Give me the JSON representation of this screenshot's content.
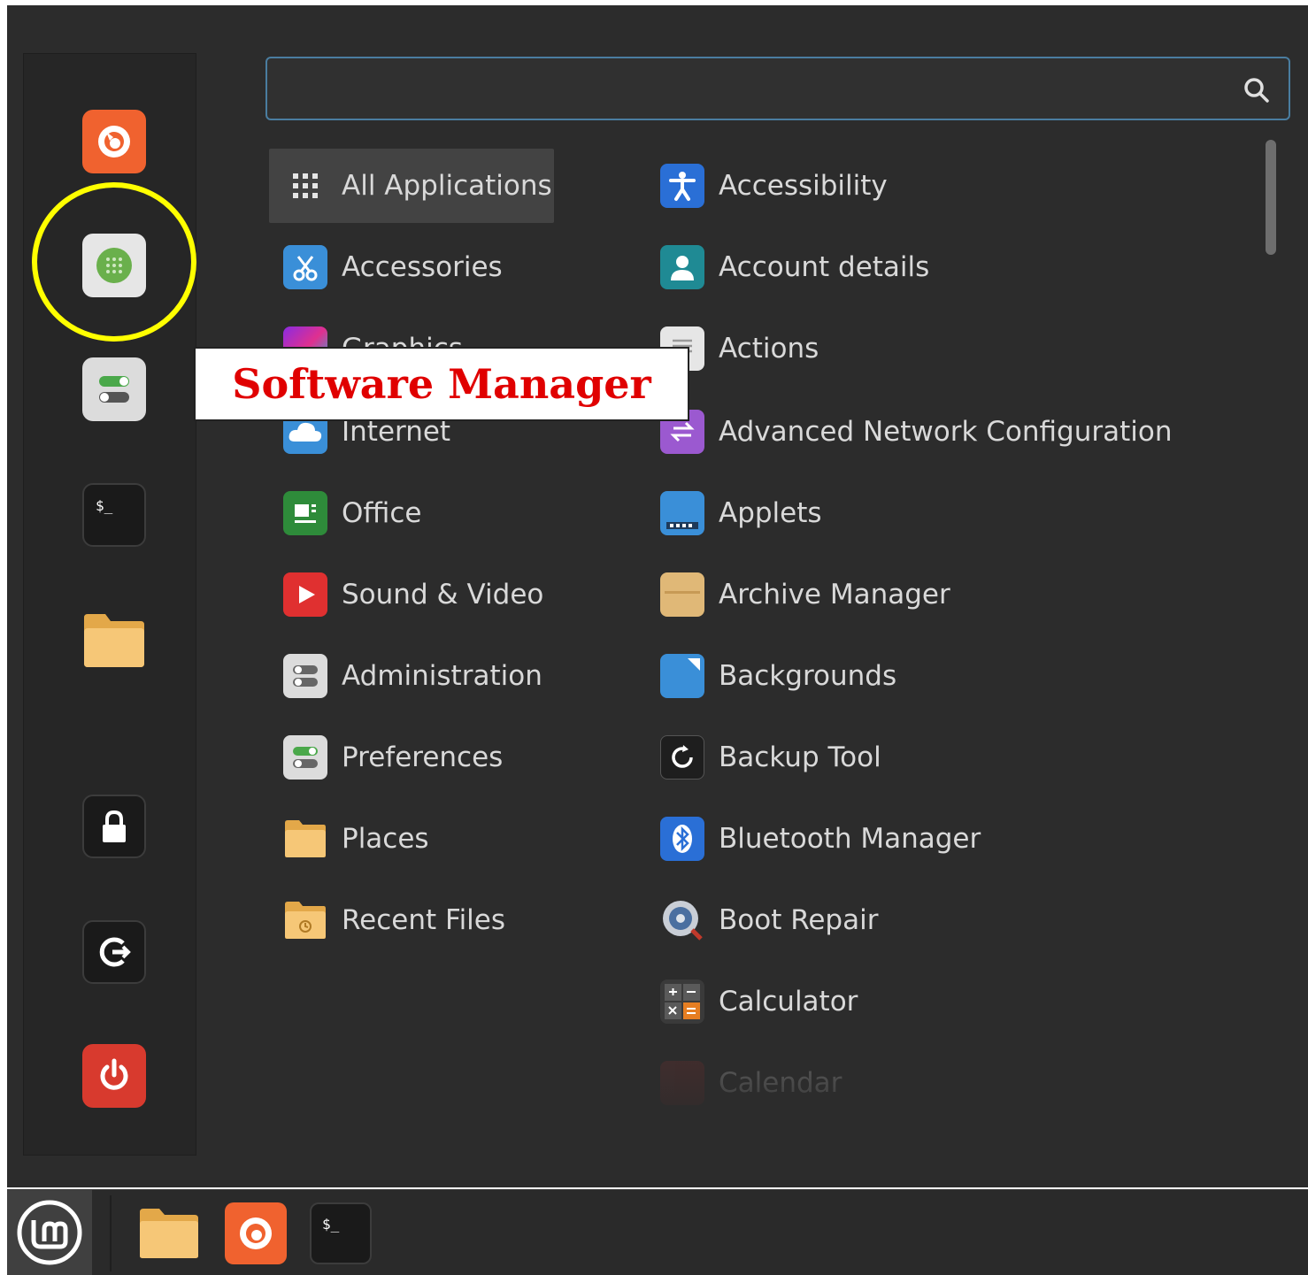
{
  "search": {
    "value": "",
    "placeholder": ""
  },
  "favorites": [
    {
      "name": "Firefox",
      "icon": "firefox-icon"
    },
    {
      "name": "Software Manager",
      "icon": "software-manager-icon"
    },
    {
      "name": "System Settings",
      "icon": "settings-toggle-icon"
    },
    {
      "name": "Terminal",
      "icon": "terminal-icon"
    },
    {
      "name": "Files",
      "icon": "folder-icon"
    },
    {
      "name": "Lock Screen",
      "icon": "lock-icon"
    },
    {
      "name": "Log Out",
      "icon": "logout-icon"
    },
    {
      "name": "Quit",
      "icon": "power-icon"
    }
  ],
  "categories": [
    {
      "label": "All Applications",
      "icon": "grid-dots-icon",
      "active": true
    },
    {
      "label": "Accessories",
      "icon": "scissors-icon"
    },
    {
      "label": "Graphics",
      "icon": "graphics-icon"
    },
    {
      "label": "Internet",
      "icon": "cloud-icon"
    },
    {
      "label": "Office",
      "icon": "office-icon"
    },
    {
      "label": "Sound & Video",
      "icon": "play-icon"
    },
    {
      "label": "Administration",
      "icon": "admin-toggle-icon"
    },
    {
      "label": "Preferences",
      "icon": "preferences-toggle-icon"
    },
    {
      "label": "Places",
      "icon": "folder-icon"
    },
    {
      "label": "Recent Files",
      "icon": "recent-folder-icon"
    }
  ],
  "apps": [
    {
      "label": "Accessibility",
      "icon": "accessibility-icon"
    },
    {
      "label": "Account details",
      "icon": "account-icon"
    },
    {
      "label": "Actions",
      "icon": "actions-icon"
    },
    {
      "label": "Advanced Network Configuration",
      "icon": "network-config-icon"
    },
    {
      "label": "Applets",
      "icon": "applets-icon"
    },
    {
      "label": "Archive Manager",
      "icon": "archive-icon"
    },
    {
      "label": "Backgrounds",
      "icon": "backgrounds-icon"
    },
    {
      "label": "Backup Tool",
      "icon": "backup-icon"
    },
    {
      "label": "Bluetooth Manager",
      "icon": "bluetooth-icon"
    },
    {
      "label": "Boot Repair",
      "icon": "boot-repair-icon"
    },
    {
      "label": "Calculator",
      "icon": "calculator-icon"
    },
    {
      "label": "Calendar",
      "icon": "calendar-icon"
    }
  ],
  "annotation": {
    "label": "Software Manager",
    "ring_color": "#ffff00",
    "text_color": "#e00000"
  },
  "taskbar": [
    {
      "name": "Menu",
      "icon": "linux-mint-logo-icon"
    },
    {
      "name": "Files",
      "icon": "folder-icon"
    },
    {
      "name": "Firefox",
      "icon": "firefox-icon"
    },
    {
      "name": "Terminal",
      "icon": "terminal-icon"
    }
  ],
  "colors": {
    "menu_bg": "#2c2c2c",
    "sidebar_bg": "#262626",
    "search_border": "#4a7da0",
    "text": "#d9d9d9",
    "active_bg": "#434343"
  }
}
